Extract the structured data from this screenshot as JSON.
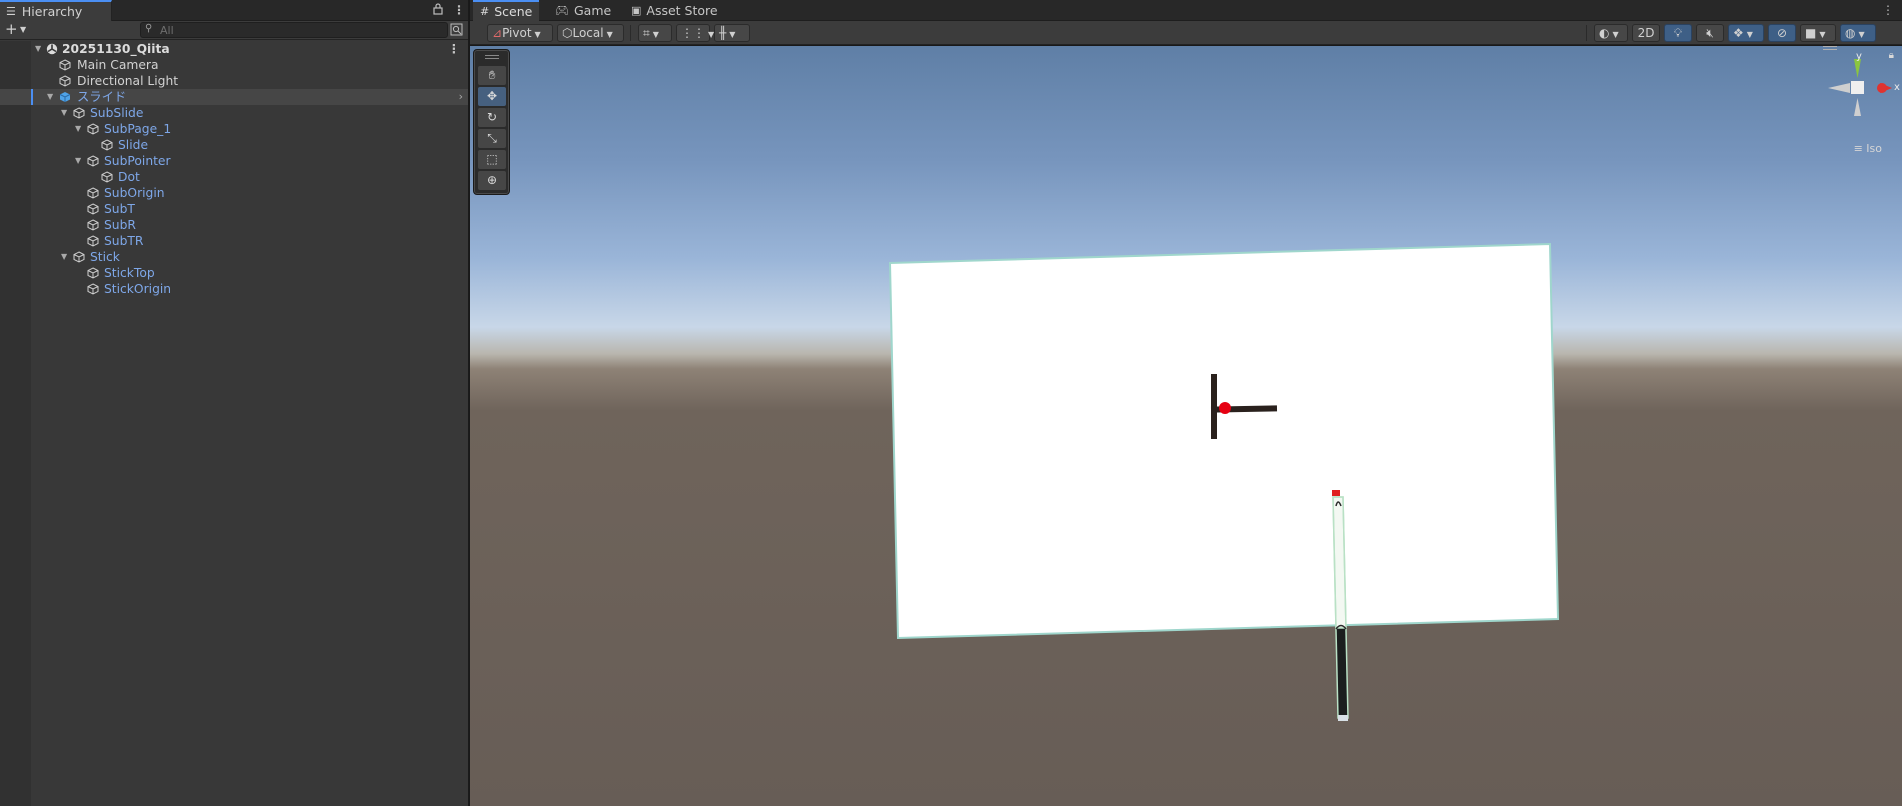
{
  "hierarchy": {
    "tab_title": "Hierarchy",
    "search_placeholder": "All",
    "items": [
      {
        "label": "20251130_Qiita",
        "kind": "scene"
      },
      {
        "label": "Main Camera",
        "kind": "plain"
      },
      {
        "label": "Directional Light",
        "kind": "plain"
      },
      {
        "label": "スライド",
        "kind": "prefab"
      },
      {
        "label": "SubSlide",
        "kind": "prefab"
      },
      {
        "label": "SubPage_1",
        "kind": "prefab"
      },
      {
        "label": "Slide",
        "kind": "prefab"
      },
      {
        "label": "SubPointer",
        "kind": "prefab"
      },
      {
        "label": "Dot",
        "kind": "prefab"
      },
      {
        "label": "SubOrigin",
        "kind": "prefab"
      },
      {
        "label": "SubT",
        "kind": "prefab"
      },
      {
        "label": "SubR",
        "kind": "prefab"
      },
      {
        "label": "SubTR",
        "kind": "prefab"
      },
      {
        "label": "Stick",
        "kind": "prefab"
      },
      {
        "label": "StickTop",
        "kind": "prefab"
      },
      {
        "label": "StickOrigin",
        "kind": "prefab"
      }
    ],
    "selected": "スライド"
  },
  "scene": {
    "tabs": [
      {
        "label": "Scene",
        "active": true,
        "icon": "grid-icon"
      },
      {
        "label": "Game",
        "active": false,
        "icon": "gamepad-icon"
      },
      {
        "label": "Asset Store",
        "active": false,
        "icon": "bag-icon"
      }
    ],
    "toolbar": {
      "pivot_label": "Pivot",
      "local_label": "Local",
      "mode_2d_label": "2D"
    },
    "gizmo": {
      "y_label": "y",
      "x_label": "x",
      "projection_label": "Iso"
    }
  },
  "colors": {
    "accent": "#4b8ff3",
    "prefab_text": "#7ea7e8",
    "axis_x": "#e0332f",
    "axis_y": "#8bc53f",
    "dot": "#e60012"
  }
}
